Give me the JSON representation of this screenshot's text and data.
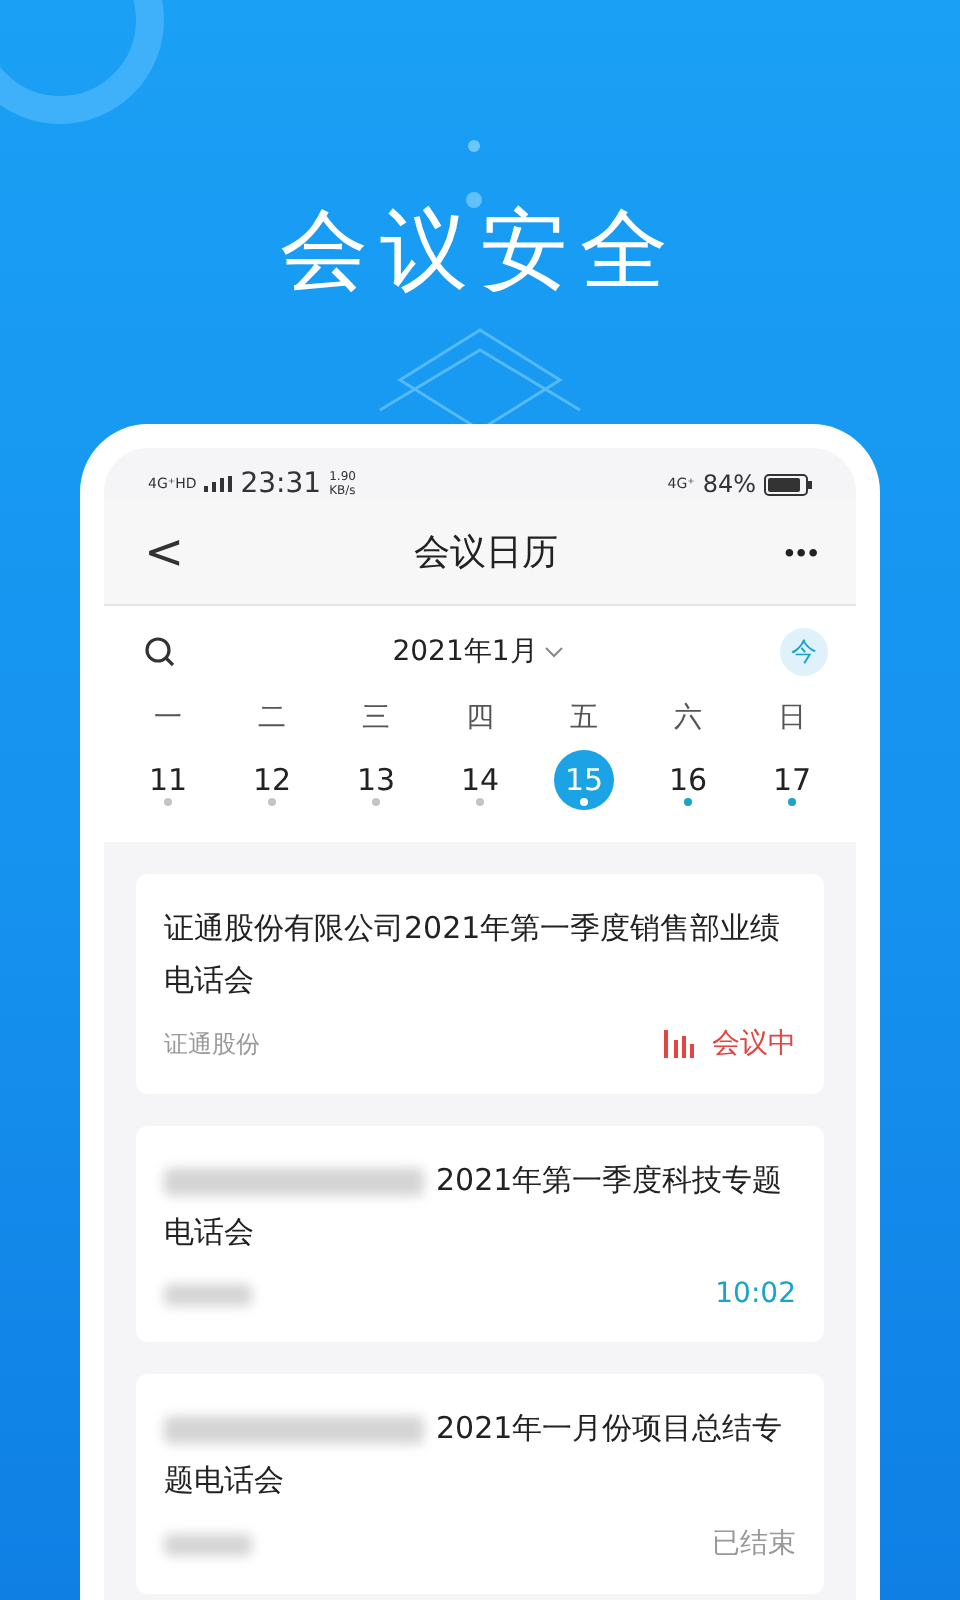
{
  "headline": "会议安全",
  "status_bar": {
    "network": "4G⁺HD",
    "time": "23:31",
    "speed_value": "1.90",
    "speed_unit": "KB/s",
    "network_right": "4G⁺",
    "battery": "84%"
  },
  "nav": {
    "back": "<",
    "title": "会议日历",
    "more": "•••"
  },
  "calendar": {
    "month": "2021年1月",
    "today": "今",
    "weekdays": [
      "一",
      "二",
      "三",
      "四",
      "五",
      "六",
      "日"
    ],
    "days": [
      {
        "label": "11",
        "selected": false,
        "color": "#c4c4c4"
      },
      {
        "label": "12",
        "selected": false,
        "color": "#c4c4c4"
      },
      {
        "label": "13",
        "selected": false,
        "color": "#c4c4c4"
      },
      {
        "label": "14",
        "selected": false,
        "color": "#c4c4c4"
      },
      {
        "label": "15",
        "selected": true,
        "color": "#ffffff"
      },
      {
        "label": "16",
        "selected": false,
        "color": "#1aa3c8"
      },
      {
        "label": "17",
        "selected": false,
        "color": "#1aa3c8"
      }
    ]
  },
  "meetings": [
    {
      "title": "证通股份有限公司2021年第一季度销售部业绩电话会",
      "company": "证通股份",
      "redacted": false,
      "kind": "live",
      "status": "会议中"
    },
    {
      "title": "2021年第一季度科技专题电话会",
      "redacted": true,
      "kind": "time",
      "status": "10:02"
    },
    {
      "title": "2021年一月份项目总结专题电话会",
      "redacted": true,
      "kind": "ended",
      "status": "已结束"
    }
  ]
}
